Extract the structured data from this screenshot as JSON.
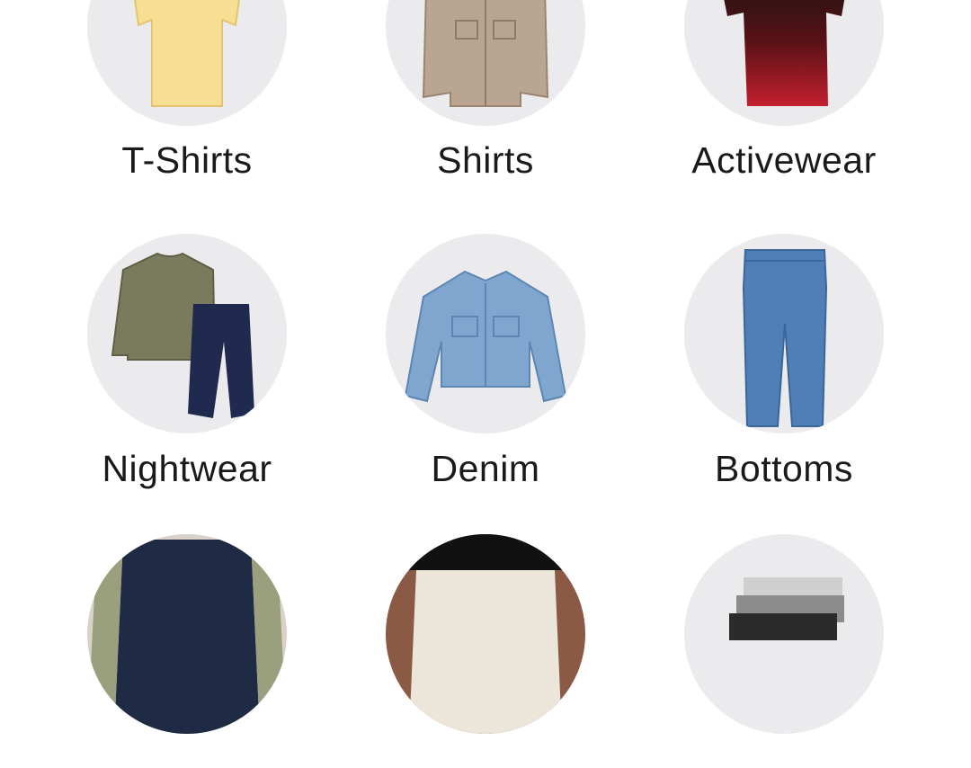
{
  "categories": [
    {
      "label": "T-Shirts",
      "icon": "tshirt-icon",
      "color": "#f6df93"
    },
    {
      "label": "Shirts",
      "icon": "shirt-icon",
      "color": "#b9a590"
    },
    {
      "label": "Activewear",
      "icon": "activewear-icon",
      "color": "#b01e2a"
    },
    {
      "label": "Nightwear",
      "icon": "nightwear-icon",
      "color": "#7a7a5c"
    },
    {
      "label": "Denim",
      "icon": "denim-jacket-icon",
      "color": "#7ea6cf"
    },
    {
      "label": "Bottoms",
      "icon": "jeans-icon",
      "color": "#4f7fb7"
    },
    {
      "label": "",
      "icon": "chinos-icon",
      "color": "#1f2a44"
    },
    {
      "label": "",
      "icon": "white-pants-icon",
      "color": "#ece6da"
    },
    {
      "label": "",
      "icon": "underwear-icon",
      "color": "#8c8c8c"
    }
  ]
}
